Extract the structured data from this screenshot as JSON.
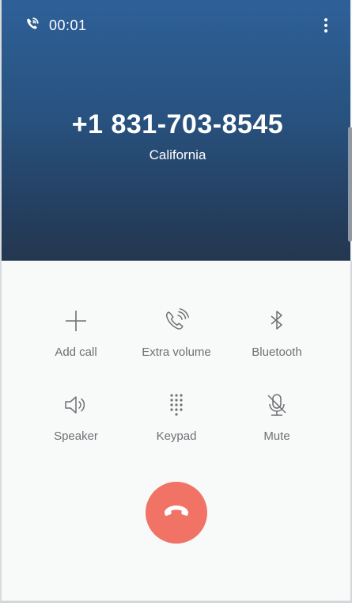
{
  "status": {
    "timer": "00:01",
    "call_icon": "wifi-call-icon",
    "menu_icon": "more-vertical-icon"
  },
  "caller": {
    "number": "+1 831-703-8545",
    "location": "California"
  },
  "actions": [
    {
      "label": "Add call",
      "icon": "plus-icon"
    },
    {
      "label": "Extra volume",
      "icon": "extra-volume-icon"
    },
    {
      "label": "Bluetooth",
      "icon": "bluetooth-icon"
    },
    {
      "label": "Speaker",
      "icon": "speaker-icon"
    },
    {
      "label": "Keypad",
      "icon": "keypad-icon"
    },
    {
      "label": "Mute",
      "icon": "mic-off-icon"
    }
  ],
  "end_call": {
    "icon": "end-call-icon",
    "color": "#f07366"
  },
  "colors": {
    "header_top": "#2e6098",
    "header_bottom": "#243750",
    "label_gray": "#6d7174",
    "background": "#f8f9f9"
  }
}
